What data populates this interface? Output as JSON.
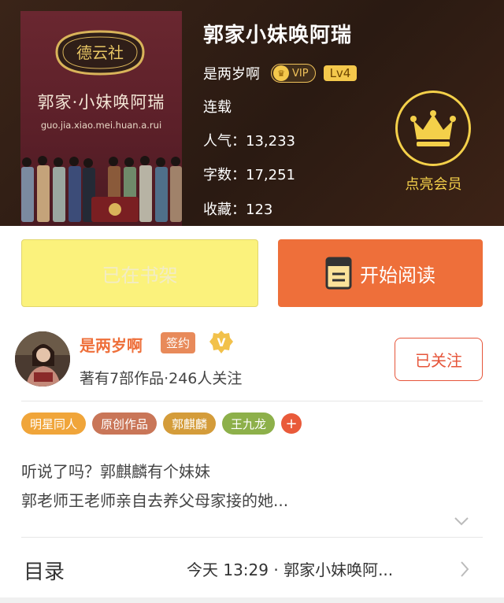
{
  "book": {
    "title": "郭家小妹唤阿瑞",
    "author": "是两岁啊",
    "vip_label": "VIP",
    "level": "Lv4",
    "status": "连载",
    "popularity_label": "人气：",
    "popularity": "13,233",
    "word_count_label": "字数：",
    "word_count": "17,251",
    "favorites_label": "收藏：",
    "favorites": "123"
  },
  "cover": {
    "badge_text": "德云社",
    "title": "郭家·小妹唤阿瑞",
    "pinyin": "guo.jia.xiao.mei.huan.a.rui",
    "center_mark": "德"
  },
  "membership": {
    "label": "点亮会员",
    "icon": "crown-icon"
  },
  "actions": {
    "shelf_label": "已在书架",
    "read_label": "开始阅读"
  },
  "author_card": {
    "name": "是两岁啊",
    "sign_badge": "签约",
    "verify_badge": "V",
    "stats": "著有7部作品·246人关注",
    "follow_label": "已关注"
  },
  "tags": [
    {
      "label": "明星同人",
      "color": "#f0a53a"
    },
    {
      "label": "原创作品",
      "color": "#c97658"
    },
    {
      "label": "郭麒麟",
      "color": "#d49c3a"
    },
    {
      "label": "王九龙",
      "color": "#8db04a"
    }
  ],
  "tag_more": "+",
  "description": {
    "line1": "听说了吗？郭麒麟有个妹妹",
    "line2": "郭老师王老师亲自去养父母家接的她..."
  },
  "toc": {
    "label": "目录",
    "latest": "今天 13:29 · 郭家小妹唤阿..."
  },
  "colors": {
    "accent": "#ee6f3a",
    "shelf_button": "#fbf27c",
    "gold": "#f4d04a"
  }
}
